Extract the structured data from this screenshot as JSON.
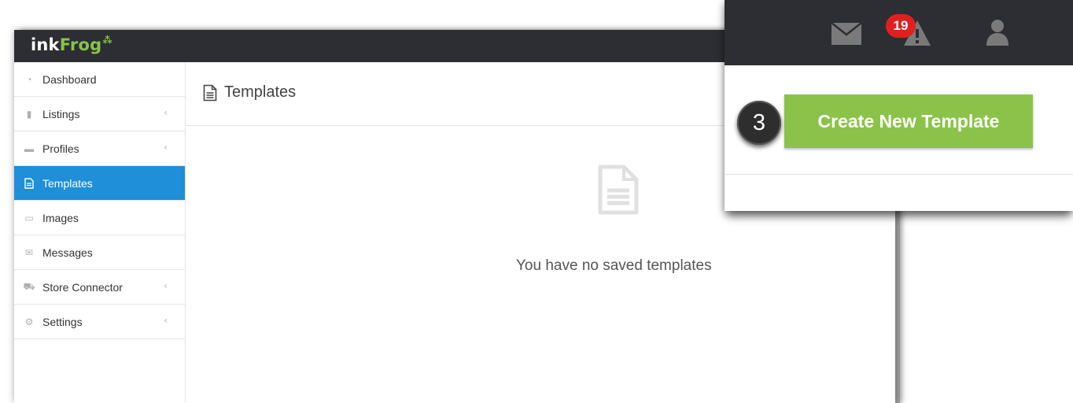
{
  "logo": {
    "ink": "ink",
    "frog": "Frog"
  },
  "sidebar": {
    "items": [
      {
        "label": "Dashboard",
        "icon": "dashboard-icon"
      },
      {
        "label": "Listings",
        "icon": "file-icon",
        "chevron": "‹"
      },
      {
        "label": "Profiles",
        "icon": "briefcase-icon",
        "chevron": "‹"
      },
      {
        "label": "Templates",
        "icon": "file-text-icon",
        "active": true
      },
      {
        "label": "Images",
        "icon": "image-icon"
      },
      {
        "label": "Messages",
        "icon": "envelope-icon"
      },
      {
        "label": "Store Connector",
        "icon": "cart-icon",
        "chevron": "‹"
      },
      {
        "label": "Settings",
        "icon": "gear-icon",
        "chevron": "‹"
      }
    ]
  },
  "main": {
    "title": "Templates",
    "empty_message": "You have no saved templates"
  },
  "callout": {
    "notification_count": "19",
    "create_button_label": "Create New Template",
    "step_number": "3"
  },
  "colors": {
    "topbar": "#2c2e33",
    "active": "#1e8fd8",
    "brand_green": "#8bc34a",
    "badge_red": "#e02020"
  }
}
